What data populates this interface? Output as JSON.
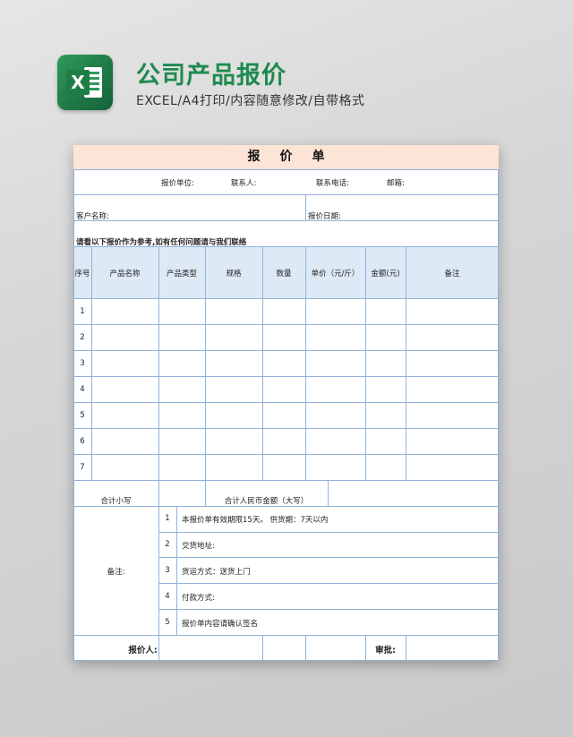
{
  "header": {
    "title": "公司产品报价",
    "subtitle": "EXCEL/A4打印/内容随意修改/自带格式",
    "logo_letter": "X"
  },
  "sheet": {
    "title": "报价单",
    "info_row": {
      "unit": "报价单位:",
      "contact": "联系人:",
      "phone": "联系电话:",
      "email": "邮箱:"
    },
    "customer_label": "客户名称:",
    "date_label": "报价日期:",
    "note_line": "请看以下报价作为参考,如有任何问题请与我们联络",
    "columns": [
      "序号",
      "产品名称",
      "产品类型",
      "规格",
      "数量",
      "单价（元/斤）",
      "金额(元)",
      "备注"
    ],
    "rows": [
      "1",
      "2",
      "3",
      "4",
      "5",
      "6",
      "7"
    ],
    "total_small": "合计小写",
    "total_big": "合计人民币金额（大写）",
    "remarks_label": "备注:",
    "remarks": [
      {
        "num": "1",
        "text": "本报价单有效期限15天。    供货期：7天以内"
      },
      {
        "num": "2",
        "text": "交货地址:"
      },
      {
        "num": "3",
        "text": "货运方式：送货上门"
      },
      {
        "num": "4",
        "text": "付款方式:"
      },
      {
        "num": "5",
        "text": "报价单内容请确认签名"
      }
    ],
    "quoter_label": "报价人:",
    "approver_label": "审批:"
  },
  "colors": {
    "brand_green": "#1f8a4f",
    "title_band": "#fce4d6",
    "header_band": "#dde9f5",
    "grid": "#8fb3d9"
  }
}
